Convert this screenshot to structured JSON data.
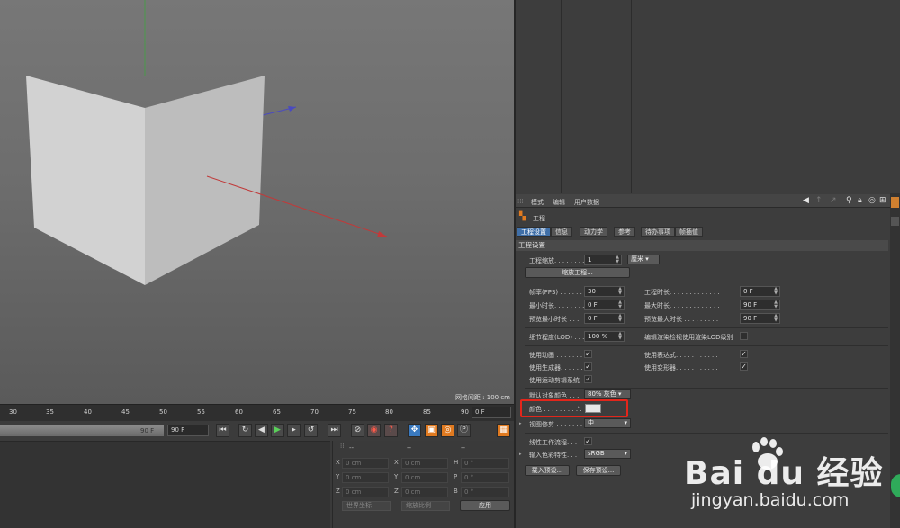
{
  "viewport": {
    "grid_spacing": "网格间距 : 100 cm"
  },
  "timeline": {
    "ticks": [
      "30",
      "35",
      "40",
      "45",
      "50",
      "55",
      "60",
      "65",
      "70",
      "75",
      "80",
      "85",
      "90"
    ],
    "current_frame": "0 F",
    "slider_end": "90 F",
    "end_frame": "90 F"
  },
  "transport_icons": [
    "go-to-start-icon",
    "previous-key-icon",
    "play-backward-icon",
    "play-icon",
    "next-frame-icon",
    "loop-icon",
    "go-to-end-icon",
    "record-icon",
    "auto-key-icon",
    "keyframe-icon",
    "move-key-icon",
    "scale-key-icon",
    "rotate-key-icon",
    "param-key-icon",
    "timeline-icon"
  ],
  "coordinates": {
    "headers": [
      "--",
      "--",
      "--"
    ],
    "rows": [
      {
        "a": "X",
        "av": "0 cm",
        "b": "X",
        "bv": "0 cm",
        "c": "H",
        "cv": "0 °"
      },
      {
        "a": "Y",
        "av": "0 cm",
        "b": "Y",
        "bv": "0 cm",
        "c": "P",
        "cv": "0 °"
      },
      {
        "a": "Z",
        "av": "0 cm",
        "b": "Z",
        "bv": "0 cm",
        "c": "B",
        "cv": "0 °"
      }
    ],
    "space_dropdown": "世界坐标",
    "scale_dropdown": "缩放比例",
    "apply": "应用"
  },
  "attributes": {
    "menu": [
      "模式",
      "编辑",
      "用户数据"
    ],
    "title": "工程",
    "tabs": [
      "工程设置",
      "信息",
      "动力学",
      "参考",
      "待办事项",
      "帧插值"
    ],
    "section": "工程设置",
    "project_scale_label": "工程缩放. . . . . . . .",
    "project_scale_value": "1",
    "project_scale_unit": "厘米",
    "scale_project_button": "缩放工程...",
    "fps_label": "帧率(FPS) . . . . . .",
    "fps_value": "30",
    "project_time_label": "工程时长. . . . . . . . . . . . .",
    "project_time_value": "0 F",
    "min_time_label": "最小时长. . . . . . . .",
    "min_time_value": "0 F",
    "max_time_label": "最大时长. . . . . . . . . . . . .",
    "max_time_value": "90 F",
    "preview_min_label": "预览最小时长 . . .",
    "preview_min_value": "0 F",
    "preview_max_label": "预览最大时长 . . . . . . . . .",
    "preview_max_value": "90 F",
    "lod_label": "细节程度(LOD) . . .",
    "lod_value": "100 %",
    "render_lod_label": "编辑渲染检视使用渲染LOD级别",
    "use_animation_label": "使用动画 . . . . . . . . .",
    "use_expression_label": "使用表达式. . . . . . . . . . .",
    "use_generator_label": "使用生成器. . . . . . .",
    "use_deformer_label": "使用变形器. . . . . . . . . . .",
    "use_motion_clip_label": "使用运动剪辑系统",
    "default_color_label": "默认对象颜色 . . .",
    "default_color_value": "80% 灰色",
    "color_label": "颜色 . . . . . . . . . .",
    "view_clip_label": "视图修剪 . . . . . . .",
    "view_clip_value": "中",
    "linear_workflow_label": "线性工作流程. . . .",
    "input_color_label": "输入色彩特性. . . .",
    "input_color_value": "sRGB",
    "load_preset": "载入预设...",
    "save_preset": "保存预设..."
  },
  "colors": {
    "accent": "#3f6fa8",
    "highlight": "#e3261b",
    "swatch": "#e6e6e6"
  },
  "watermark": {
    "logo": "Bai du 经验",
    "url": "jingyan.baidu.com"
  }
}
